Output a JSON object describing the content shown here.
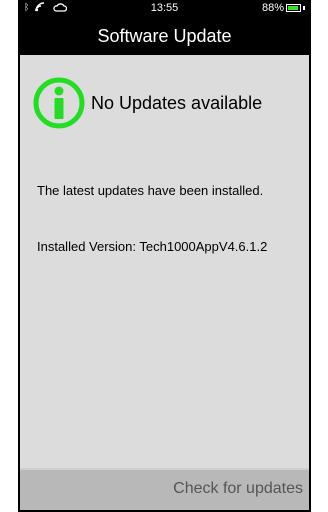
{
  "status_bar": {
    "time": "13:55",
    "battery_percent": "88%",
    "battery_level": 0.88,
    "icons": [
      "bluetooth-icon",
      "signal-icon",
      "cloud-icon"
    ]
  },
  "header": {
    "title": "Software Update"
  },
  "main": {
    "headline": "No Updates available",
    "message": "The latest updates have been installed.",
    "installed_version": "Installed Version: Tech1000AppV4.6.1.2"
  },
  "footer": {
    "check_label": "Check for updates"
  },
  "colors": {
    "accent": "#22dd22",
    "title_bar": "#000000",
    "background": "#dcdcdc",
    "footer": "#b8b8b8"
  }
}
